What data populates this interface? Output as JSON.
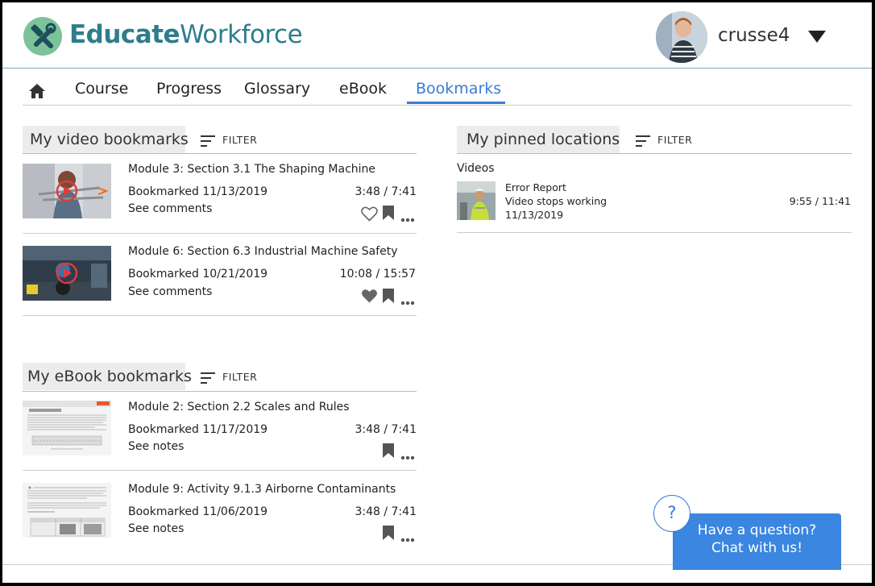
{
  "brand": {
    "name_bold": "Educate",
    "name_thin": "Workforce"
  },
  "user": {
    "name": "crusse4"
  },
  "nav": {
    "items": [
      "Course",
      "Progress",
      "Glossary",
      "eBook",
      "Bookmarks"
    ]
  },
  "video_bookmarks": {
    "heading": "My video bookmarks",
    "filter_label": "FILTER",
    "items": [
      {
        "title": "Module 3: Section 3.1 The Shaping Machine",
        "bookmarked": "Bookmarked 11/13/2019",
        "time": "3:48 / 7:41",
        "link": "See comments",
        "liked": false
      },
      {
        "title": "Module 6: Section 6.3 Industrial Machine Safety",
        "bookmarked": "Bookmarked 10/21/2019",
        "time": "10:08 / 15:57",
        "link": "See comments",
        "liked": true
      }
    ]
  },
  "ebook_bookmarks": {
    "heading": "My eBook bookmarks",
    "filter_label": "FILTER",
    "items": [
      {
        "title": "Module 2: Section 2.2 Scales and Rules",
        "bookmarked": "Bookmarked 11/17/2019",
        "time": "3:48 / 7:41",
        "link": "See notes"
      },
      {
        "title": "Module 9: Activity 9.1.3 Airborne Contaminants",
        "bookmarked": "Bookmarked 11/06/2019",
        "time": "3:48 / 7:41",
        "link": "See notes"
      }
    ]
  },
  "pinned": {
    "heading": "My pinned locations",
    "filter_label": "FILTER",
    "group_label": "Videos",
    "items": [
      {
        "title": "Error Report",
        "subtitle": "Video stops working",
        "date": "11/13/2019",
        "time": "9:55 / 11:41"
      }
    ]
  },
  "chat": {
    "help_symbol": "?",
    "line1": "Have a question?",
    "line2": "Chat with us!"
  },
  "colors": {
    "accent": "#3a7bd5",
    "brand_text": "#2e7d8c",
    "logo_green": "#7cc39a",
    "play_red": "#e0393e",
    "chat_blue": "#3a86e0"
  }
}
